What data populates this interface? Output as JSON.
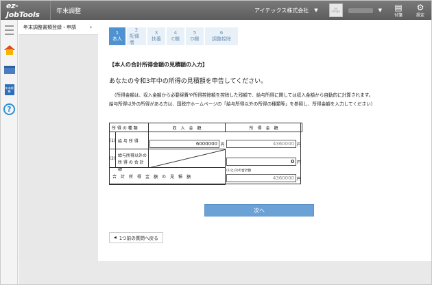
{
  "header": {
    "logo": "ez-JobTools",
    "app_title": "年末調整",
    "company": "アイテックス株式会社",
    "avatar_text": "no image",
    "attach_label": "付箋",
    "settings_label": "設定"
  },
  "side_menu": {
    "items": [
      {
        "label": "年末調整書類登録・申請"
      }
    ]
  },
  "rail": {
    "doc_icon_text": "年末調整"
  },
  "steps": [
    {
      "num": "1",
      "label": "本人",
      "active": true
    },
    {
      "num": "2",
      "label": "配偶者"
    },
    {
      "num": "3",
      "label": "扶養"
    },
    {
      "num": "4",
      "label": "C欄"
    },
    {
      "num": "5",
      "label": "D欄"
    },
    {
      "num": "6",
      "label": "調整控除"
    }
  ],
  "content": {
    "section_title": "【本人の合計所得金額の見積額の入力】",
    "lead": "あなたの令和3年中の所得の見積額を申告してください。",
    "note1": "（所得金額は、収入金額から必要経費や所得控除額を控除した残額で、給与所得に関しては収入金額から自動的に計算されます。",
    "note2": "給与所得以外の所得がある方は、国税庁ホームページの「給与所得以外の所得の種類等」を参照し、所得金額を入力してください）"
  },
  "table": {
    "h_type": "所 得 の 種 類",
    "h_income": "収　入　金　額",
    "h_shotoku": "所　得　金　額",
    "r1_no": "(1)",
    "r1_label": "給 与 所 得",
    "r1_income": "6000000",
    "r1_unit": "円",
    "r1_shotoku": "4360000",
    "r1_unit2": "円",
    "r2_no": "(2)",
    "r2_label1": "給与所得以外の",
    "r2_label2": "所 得 の 合 計 額",
    "r2_shotoku": "0",
    "r2_unit": "円",
    "total_label": "合　計　所　得　金　額　の　見　積　額",
    "total_sub": "(1)と(2)の合計額",
    "total_value": "4360000",
    "total_unit": "円"
  },
  "buttons": {
    "next": "次へ",
    "back": "1つ前の質問へ戻る"
  }
}
